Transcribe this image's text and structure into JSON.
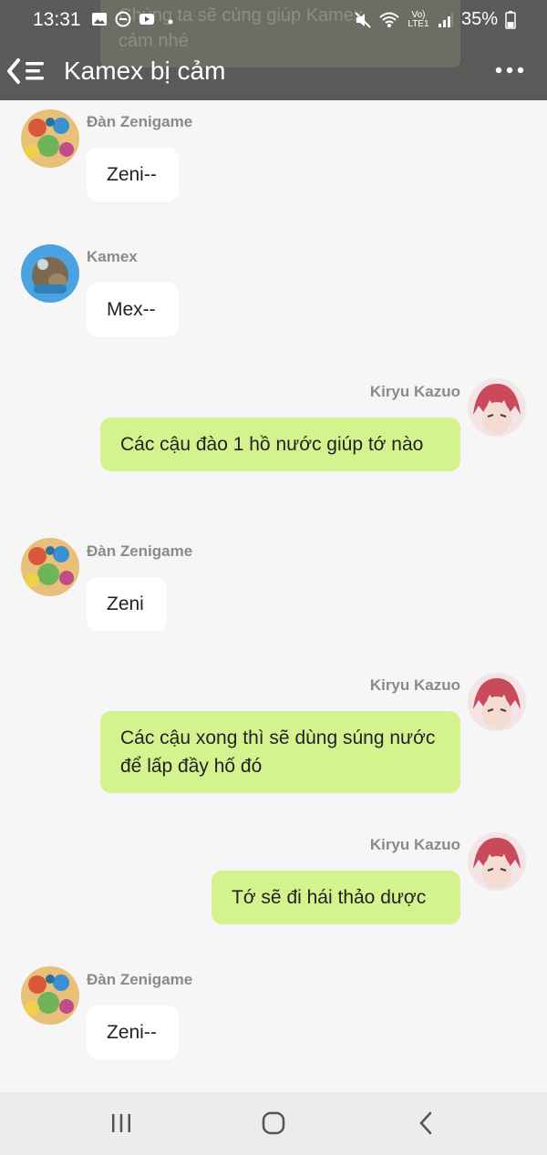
{
  "status_bar": {
    "time": "13:31",
    "battery": "35%",
    "network": "Vo) LTE1"
  },
  "notification_ghost": {
    "line1": "Chúng ta sẽ cùng giúp Kamex",
    "line2": "cảm nhé"
  },
  "header": {
    "title": "Kamex bị cảm"
  },
  "messages": [
    {
      "sender": "Đàn Zenigame",
      "text": "Zeni--",
      "direction": "in"
    },
    {
      "sender": "Kamex",
      "text": "Mex--",
      "direction": "in"
    },
    {
      "sender": "Kiryu Kazuo",
      "text": "Các cậu đào 1 hồ nước giúp tớ nào",
      "direction": "out"
    },
    {
      "sender": "Đàn Zenigame",
      "text": "Zeni",
      "direction": "in"
    },
    {
      "sender": "Kiryu Kazuo",
      "text": "Các cậu xong thì sẽ dùng súng nước để lấp đầy hố đó",
      "direction": "out"
    },
    {
      "sender": "Kiryu Kazuo",
      "text": "Tớ sẽ đi hái thảo dược",
      "direction": "out"
    },
    {
      "sender": "Đàn Zenigame",
      "text": "Zeni--",
      "direction": "in"
    }
  ],
  "colors": {
    "header_bg": "#5a5a5a",
    "outgoing_bubble": "#d4f28e",
    "incoming_bubble": "#ffffff",
    "chat_bg": "#f6f6f6"
  },
  "icons": [
    "back-list-icon",
    "more-icon",
    "recents-icon",
    "home-icon",
    "back-nav-icon"
  ]
}
